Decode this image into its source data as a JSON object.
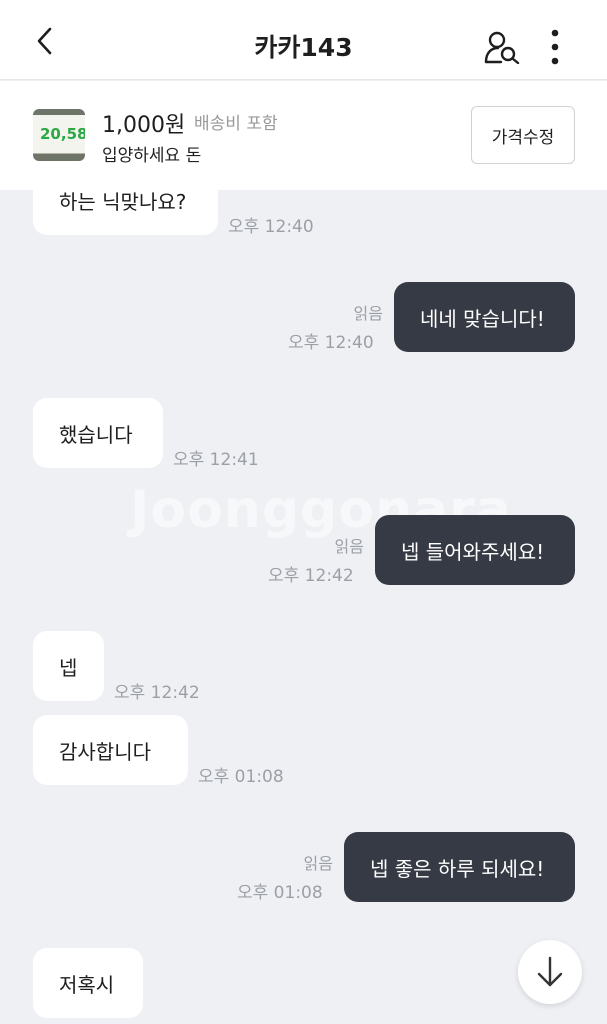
{
  "header": {
    "title": "카카143"
  },
  "product": {
    "thumb_text": "20,58",
    "price": "1,000원",
    "shipping": "배송비 포함",
    "name": "입양하세요 돈",
    "edit_label": "가격수정"
  },
  "watermark": "Joonggonara",
  "messages": [
    {
      "text": "하는 닉맞나요?",
      "time": "오후 12:40"
    },
    {
      "text": "네네 맞습니다!",
      "time": "오후 12:40",
      "read": "읽음"
    },
    {
      "text": "했습니다",
      "time": "오후 12:41"
    },
    {
      "text": "넵 들어와주세요!",
      "time": "오후 12:42",
      "read": "읽음"
    },
    {
      "text": "넵",
      "time": "오후 12:42"
    },
    {
      "text": "감사합니다",
      "time": "오후 01:08"
    },
    {
      "text": "넵 좋은 하루 되세요!",
      "time": "오후 01:08",
      "read": "읽음"
    },
    {
      "text": "저혹시"
    }
  ],
  "icons": {
    "back": "chevron-left-icon",
    "profile_search": "user-search-icon",
    "more": "more-vertical-icon",
    "scroll_down": "arrow-down-icon"
  },
  "colors": {
    "outgoing_bubble": "#353a44",
    "incoming_bubble": "#ffffff",
    "chat_background": "#eef0f4",
    "thumb_accent": "#2aa843"
  }
}
